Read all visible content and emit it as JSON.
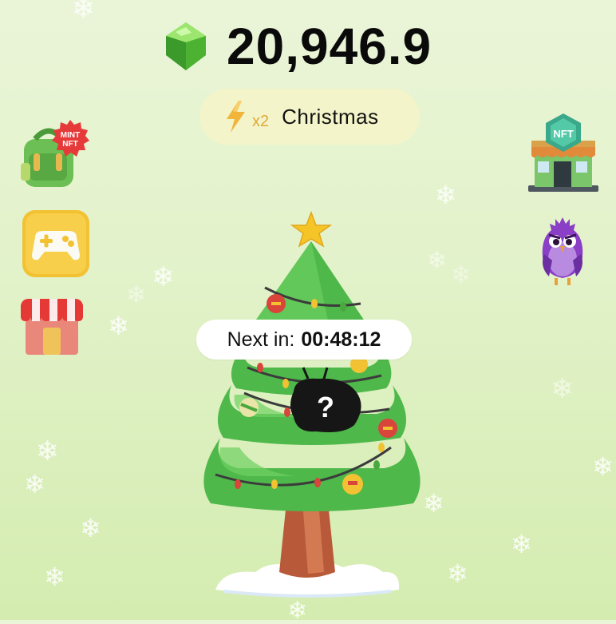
{
  "balance": {
    "value": "20,946.9",
    "currency_icon": "green-gem-icon"
  },
  "boost": {
    "icon": "lightning-bolt-icon",
    "multiplier": "x2",
    "label": "Christmas"
  },
  "left_menu": [
    {
      "name": "mint-nft-backpack",
      "icon": "backpack-icon",
      "badge_text": "MINT NFT"
    },
    {
      "name": "games",
      "icon": "gamepad-icon"
    },
    {
      "name": "shop",
      "icon": "shop-stall-icon"
    }
  ],
  "right_menu": [
    {
      "name": "nft-store",
      "icon": "nft-store-icon",
      "sign_text": "NFT"
    },
    {
      "name": "purple-bird",
      "icon": "purple-bird-icon"
    }
  ],
  "timer": {
    "label": "Next in:",
    "value": "00:48:12"
  },
  "tree": {
    "icon": "christmas-tree-icon",
    "mystery_glyph": "?"
  },
  "colors": {
    "background": "#e2f2c9",
    "balance_text": "#0a0a0a",
    "boost_pill": "#f3f4c9",
    "multiplier": "#e2a838",
    "tree_green": "#4fb84a",
    "trunk": "#b85a3a"
  }
}
